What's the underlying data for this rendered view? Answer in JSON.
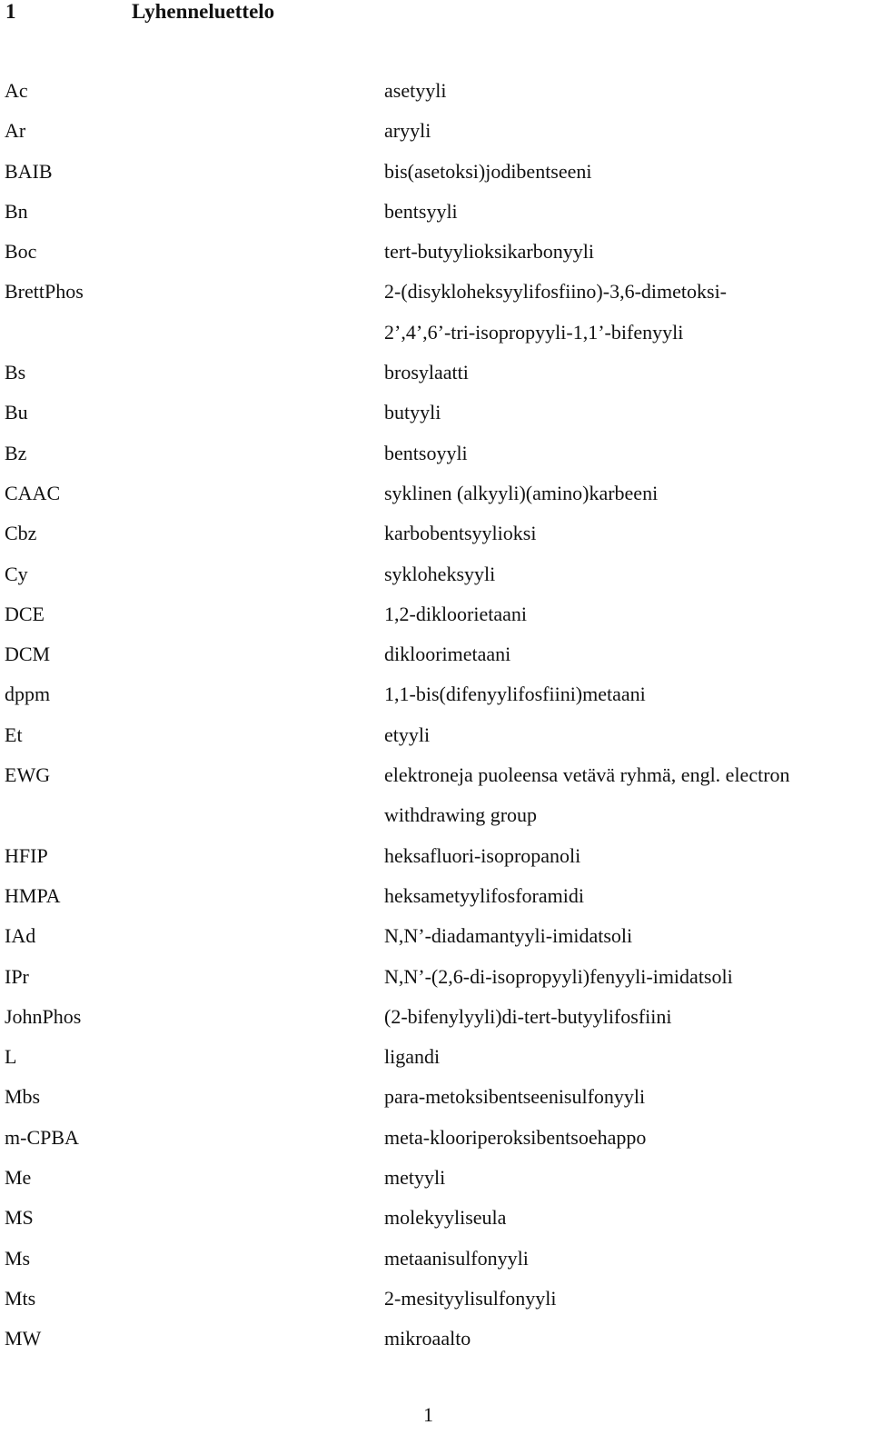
{
  "heading": {
    "number": "1",
    "title": "Lyhenneluettelo"
  },
  "entries": [
    {
      "abbr": "Ac",
      "def": "asetyyli"
    },
    {
      "abbr": "Ar",
      "def": "aryyli"
    },
    {
      "abbr": "BAIB",
      "def": "bis(asetoksi)jodibentseeni"
    },
    {
      "abbr": "Bn",
      "def": "bentsyyli"
    },
    {
      "abbr": "Boc",
      "def": "tert-butyylioksikarbonyyli"
    },
    {
      "abbr": "BrettPhos",
      "def": "2-(disykloheksyylifosfiino)-3,6-dimetoksi-"
    },
    {
      "abbr": "",
      "def": "2’,4’,6’-tri-isopropyyli-1,1’-bifenyyli"
    },
    {
      "abbr": "Bs",
      "def": "brosylaatti"
    },
    {
      "abbr": "Bu",
      "def": "butyyli"
    },
    {
      "abbr": "Bz",
      "def": "bentsoyyli"
    },
    {
      "abbr": "CAAC",
      "def": "syklinen (alkyyli)(amino)karbeeni"
    },
    {
      "abbr": "Cbz",
      "def": "karbobentsyylioksi"
    },
    {
      "abbr": "Cy",
      "def": "sykloheksyyli"
    },
    {
      "abbr": "DCE",
      "def": "1,2-dikloorietaani"
    },
    {
      "abbr": "DCM",
      "def": "dikloorimetaani"
    },
    {
      "abbr": "dppm",
      "def": "1,1-bis(difenyylifosfiini)metaani"
    },
    {
      "abbr": "Et",
      "def": "etyyli"
    },
    {
      "abbr": "EWG",
      "def": "elektroneja puoleensa vetävä ryhmä, engl. electron"
    },
    {
      "abbr": "",
      "def": "withdrawing group"
    },
    {
      "abbr": "HFIP",
      "def": "heksafluori-isopropanoli"
    },
    {
      "abbr": "HMPA",
      "def": "heksametyylifosforamidi"
    },
    {
      "abbr": "IAd",
      "def": "N,N’-diadamantyyli-imidatsoli"
    },
    {
      "abbr": "IPr",
      "def": "N,N’-(2,6-di-isopropyyli)fenyyli-imidatsoli"
    },
    {
      "abbr": "JohnPhos",
      "def": "(2-bifenylyyli)di-tert-butyylifosfiini"
    },
    {
      "abbr": "L",
      "def": "ligandi"
    },
    {
      "abbr": "Mbs",
      "def": "para-metoksibentseenisulfonyyli"
    },
    {
      "abbr": "m-CPBA",
      "def": "meta-klooriperoksibentsoehappo"
    },
    {
      "abbr": "Me",
      "def": "metyyli"
    },
    {
      "abbr": "MS",
      "def": "molekyyliseula"
    },
    {
      "abbr": "Ms",
      "def": "metaanisulfonyyli"
    },
    {
      "abbr": "Mts",
      "def": "2-mesityylisulfonyyli"
    },
    {
      "abbr": "MW",
      "def": "mikroaalto"
    }
  ],
  "footer": {
    "page_number": "1"
  }
}
